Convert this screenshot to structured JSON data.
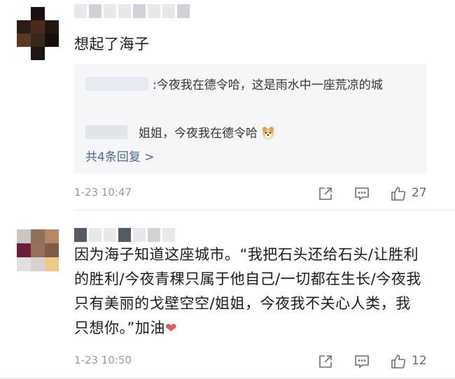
{
  "comments": [
    {
      "text": "想起了海子",
      "replies": {
        "reply1_text": ":今夜我在德令哈，这是雨水中一座荒凉的城",
        "reply2_text": "姐姐，今夜我在德令哈",
        "reply2_emoji": "dog-emoji",
        "more_link": "共4条回复 >"
      },
      "timestamp": "1-23 10:47",
      "likes": "27"
    },
    {
      "text": "因为海子知道这座城市。“我把石头还给石头/让胜利的胜利/今夜青稞只属于他自己/一切都在生长/今夜我只有美丽的戈壁空空/姐姐，今夜我不关心人类，我只想你。”加油",
      "heart": "❤",
      "timestamp": "1-23 10:50",
      "likes": "12"
    }
  ],
  "icons": {
    "share": "share-icon",
    "comment": "comment-icon",
    "like": "thumbs-up-icon"
  },
  "colors": {
    "link": "#466996",
    "reply_bg": "#f6f6f8",
    "heart": "#e05c55",
    "timestamp": "#999999"
  }
}
